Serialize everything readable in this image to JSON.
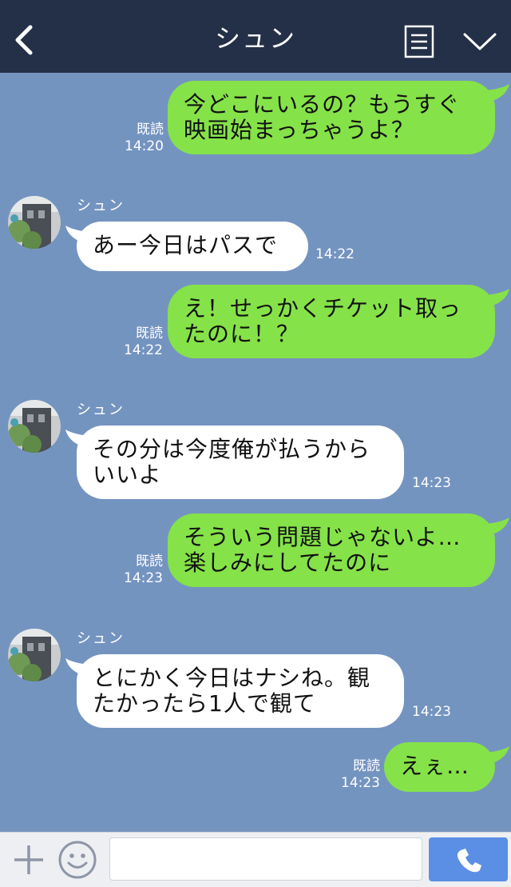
{
  "header": {
    "title": "シュン",
    "back_icon": "chevron-left-icon",
    "menu_icon": "menu-list-icon",
    "collapse_icon": "chevron-down-icon"
  },
  "messages": [
    {
      "from": "me",
      "lines": [
        "今どこにいるの？もうすぐ",
        "映画始まっちゃうよ？"
      ],
      "read": "既読",
      "time": "14:20"
    },
    {
      "from": "them",
      "sender": "シュン",
      "lines": [
        "あー今日はパスで"
      ],
      "time": "14:22"
    },
    {
      "from": "me",
      "lines": [
        "え！せっかくチケット取っ",
        "たのに！？"
      ],
      "read": "既読",
      "time": "14:22"
    },
    {
      "from": "them",
      "sender": "シュン",
      "lines": [
        "その分は今度俺が払うから",
        "いいよ"
      ],
      "time": "14:23"
    },
    {
      "from": "me",
      "lines": [
        "そういう問題じゃないよ…",
        "楽しみにしてたのに"
      ],
      "read": "既読",
      "time": "14:23"
    },
    {
      "from": "them",
      "sender": "シュン",
      "lines": [
        "とにかく今日はナシね。観",
        "たかったら1人で観て"
      ],
      "time": "14:23"
    },
    {
      "from": "me",
      "lines": [
        "えぇ…"
      ],
      "read": "既読",
      "time": "14:23"
    }
  ],
  "input_bar": {
    "plus_icon": "plus-icon",
    "emoji_icon": "smiley-icon",
    "placeholder": "",
    "call_icon": "phone-icon"
  },
  "colors": {
    "header_bg": "#243048",
    "chat_bg": "#7494c0",
    "my_bubble": "#85e249",
    "their_bubble": "#ffffff",
    "call_button": "#5b8fe6"
  }
}
